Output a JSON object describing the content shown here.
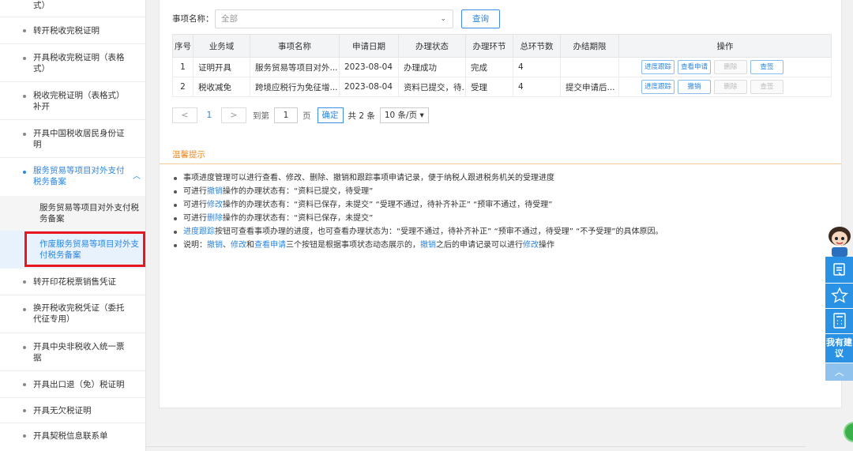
{
  "sidebar": {
    "items": [
      {
        "label": "式）"
      },
      {
        "label": "转开税收完税证明"
      },
      {
        "label": "开具税收完税证明（表格式）"
      },
      {
        "label": "税收完税证明（表格式）补开"
      },
      {
        "label": "开具中国税收居民身份证明"
      },
      {
        "label": "服务贸易等项目对外支付税务备案"
      },
      {
        "label": "服务贸易等项目对外支付税务备案"
      },
      {
        "label": "作废服务贸易等项目对外支付税务备案"
      },
      {
        "label": "转开印花税票销售凭证"
      },
      {
        "label": "换开税收完税凭证（委托代征专用）"
      },
      {
        "label": "开具中央非税收入统一票据"
      },
      {
        "label": "开具出口退（免）税证明"
      },
      {
        "label": "开具无欠税证明"
      },
      {
        "label": "开具契税信息联系单"
      }
    ]
  },
  "search": {
    "label": "事项名称：",
    "placeholder": "全部",
    "button": "查询"
  },
  "table": {
    "headers": [
      "序号",
      "业务域",
      "事项名称",
      "申请日期",
      "办理状态",
      "办理环节",
      "总环节数",
      "办结期限",
      "操作"
    ],
    "rows": [
      {
        "no": "1",
        "domain": "证明开具",
        "name": "服务贸易等项目对外...",
        "date": "2023-08-04",
        "status": "办理成功",
        "step": "完成",
        "total": "4",
        "deadline": "",
        "ops": [
          "进度跟踪",
          "查看申请",
          "删除",
          "查签"
        ]
      },
      {
        "no": "2",
        "domain": "税收减免",
        "name": "跨境应税行为免征增...",
        "date": "2023-08-04",
        "status": "资料已提交，待...",
        "step": "受理",
        "total": "4",
        "deadline": "提交申请后...",
        "ops": [
          "进度跟踪",
          "撤销",
          "删除",
          "查签"
        ]
      }
    ]
  },
  "pager": {
    "prev": "<",
    "page": "1",
    "next": ">",
    "goto": "到第",
    "input": "1",
    "unit": "页",
    "ok": "确定",
    "total": "共 2 条",
    "size": "10 条/页"
  },
  "tips": {
    "title": "温馨提示",
    "l1": "事项进度管理可以进行查看、修改、删除、撤销和跟踪事项申请记录，便于纳税人跟进税务机关的受理进度",
    "l2a": "可进行",
    "l2b": "撤销",
    "l2c": "操作的办理状态有：“资料已提交，待受理”",
    "l3a": "可进行",
    "l3b": "修改",
    "l3c": "操作的办理状态有：“资料已保存，未提交” “受理不通过，待补齐补正” “预审不通过，待受理”",
    "l4a": "可进行",
    "l4b": "删除",
    "l4c": "操作的办理状态有：“资料已保存，未提交”",
    "l5a": "进度跟踪",
    "l5b": "按钮可查看事项办理的进度，也可查看办理状态为：“受理不通过，待补齐补正” “预审不通过，待受理” “不予受理”的具体原因。",
    "l6a": "说明：",
    "l6b": "撤销",
    "l6c": "、",
    "l6d": "修改",
    "l6e": "和",
    "l6f": "查看申请",
    "l6g": "三个按钮是根据事项状态动态展示的，",
    "l6h": "撤销",
    "l6i": "之后的申请记录可以进行",
    "l6j": "修改",
    "l6k": "操作"
  },
  "float": {
    "suggest": "我有建议"
  },
  "colors": {
    "accent": "#2a86e0",
    "highlight": "#e8161e",
    "tips": "#f08a21",
    "float": "#2a92e5"
  }
}
